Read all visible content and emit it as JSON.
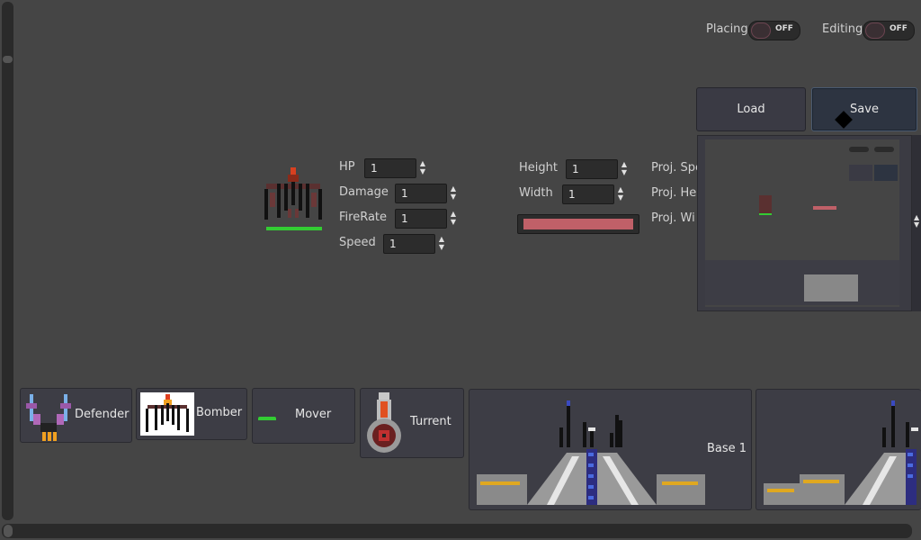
{
  "toolbar": {
    "placing_label": "Placing",
    "placing_state": "OFF",
    "editing_label": "Editing",
    "editing_state": "OFF"
  },
  "file_buttons": {
    "load": "Load",
    "save": "Save"
  },
  "stats": {
    "hp_label": "HP",
    "hp_value": "1",
    "damage_label": "Damage",
    "damage_value": "1",
    "firerate_label": "FireRate",
    "firerate_value": "1",
    "speed_label": "Speed",
    "speed_value": "1"
  },
  "size": {
    "height_label": "Height",
    "height_value": "1",
    "width_label": "Width",
    "width_value": "1",
    "color_swatch": "#c06068"
  },
  "projectile": {
    "speed_label": "Proj. Spe",
    "height_label": "Proj. He",
    "width_label": "Proj. Wi"
  },
  "palette": {
    "items": [
      {
        "label": "Defender"
      },
      {
        "label": "Bomber"
      },
      {
        "label": "Mover"
      },
      {
        "label": "Turrent"
      },
      {
        "label": "Base 1"
      }
    ]
  },
  "colors": {
    "background": "#454545",
    "toggle_text": "#dcdcdc",
    "health_bar": "#33cc33",
    "swatch": "#c06068"
  }
}
